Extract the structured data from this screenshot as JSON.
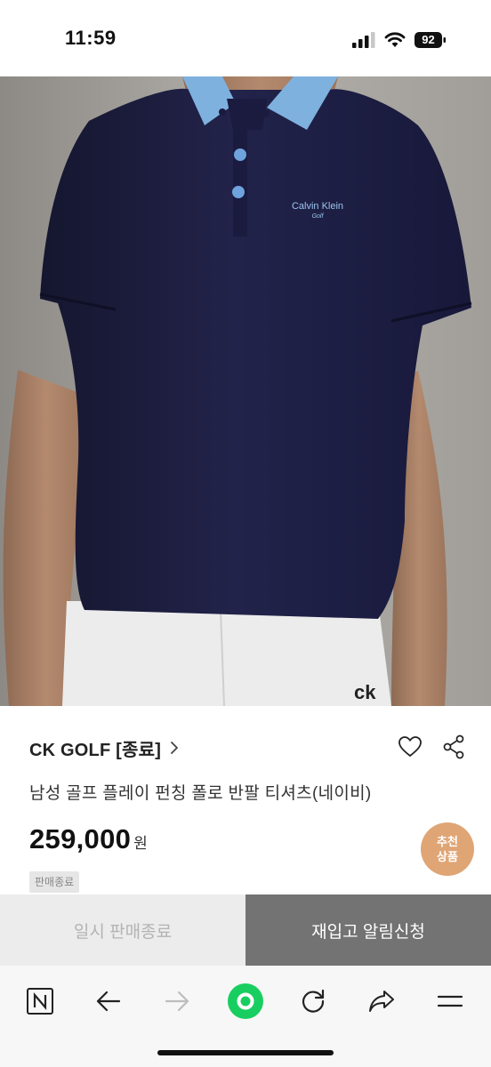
{
  "status_bar": {
    "time": "11:59",
    "battery_level": "92",
    "icons": [
      "signal-icon",
      "wifi-icon",
      "battery-icon"
    ]
  },
  "product_image": {
    "logo_main": "Calvin Klein",
    "logo_sub": "Golf",
    "pants_mark": "ck"
  },
  "product": {
    "brand": "CK GOLF [종료]",
    "title": "남성 골프 플레이 펀칭 폴로 반팔 티셔츠(네이비)",
    "price": "259,000",
    "price_unit": "원",
    "badge_line1": "추천",
    "badge_line2": "상품",
    "sale_end_tag": "판매종료"
  },
  "actions": {
    "left_label": "일시 판매종료",
    "right_label": "재입고 알림신청"
  },
  "browser_bar": {
    "icons": [
      "naver-home-icon",
      "back-arrow-icon",
      "forward-arrow-icon",
      "green-dot-icon",
      "refresh-icon",
      "share-icon",
      "menu-icon"
    ]
  },
  "colors": {
    "shirt_navy": "#1c1d3c",
    "collar_blue": "#7fb1df",
    "badge_orange": "#e0a575",
    "action_gray": "#737373",
    "naver_green": "#19ce60"
  }
}
